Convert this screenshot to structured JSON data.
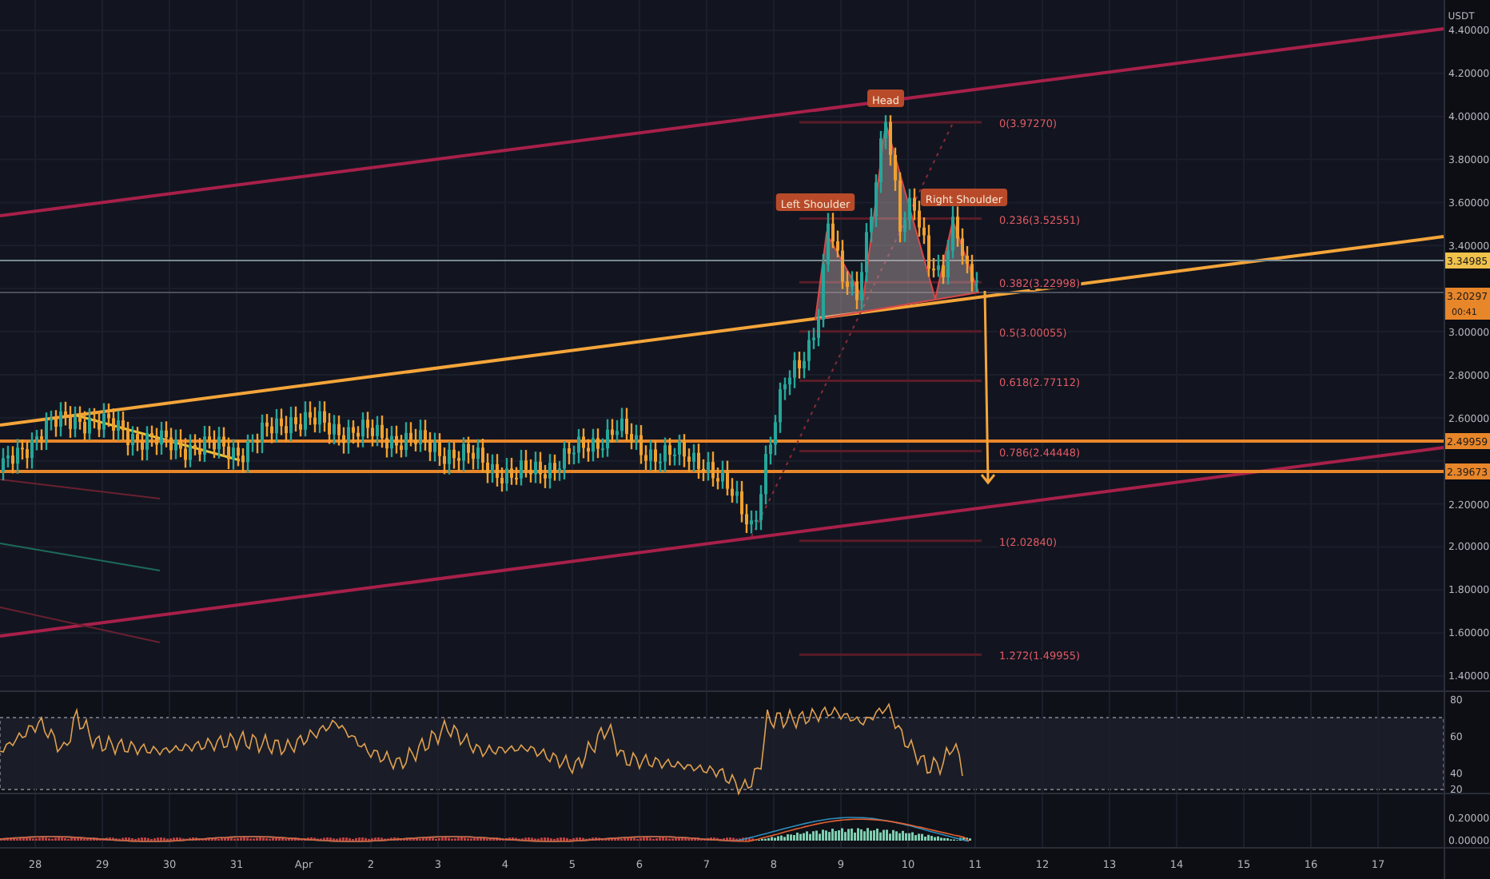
{
  "price_axis": {
    "currency": "USDT",
    "ticks": [
      "4.40000",
      "4.20000",
      "4.00000",
      "3.80000",
      "3.60000",
      "3.40000",
      "3.00000",
      "2.80000",
      "2.60000",
      "2.20000",
      "2.00000",
      "1.80000",
      "1.60000",
      "1.40000"
    ]
  },
  "price_tags": [
    {
      "label": "3.34985",
      "color": "#f0c24b"
    },
    {
      "label": "3.20297",
      "countdown": "00:41",
      "color": "#e8862a"
    },
    {
      "label": "2.49959",
      "color": "#e8862a"
    },
    {
      "label": "2.39673",
      "color": "#e8862a"
    }
  ],
  "pattern_labels": [
    {
      "text": "Left Shoulder"
    },
    {
      "text": "Head"
    },
    {
      "text": "Right Shoulder"
    }
  ],
  "fib_levels": [
    {
      "label": "0(3.97270)"
    },
    {
      "label": "0.236(3.52551)"
    },
    {
      "label": "0.382(3.22998)"
    },
    {
      "label": "0.5(3.00055)"
    },
    {
      "label": "0.618(2.77112)"
    },
    {
      "label": "0.786(2.44448)"
    },
    {
      "label": "1(2.02840)"
    },
    {
      "label": "1.272(1.49955)"
    }
  ],
  "rsi_axis": {
    "ticks": [
      "80",
      "60",
      "40",
      "20"
    ]
  },
  "macd_axis": {
    "ticks": [
      "0.20000",
      "0.00000"
    ]
  },
  "time_axis": [
    "28",
    "29",
    "30",
    "31",
    "Apr",
    "2",
    "3",
    "4",
    "5",
    "6",
    "7",
    "8",
    "9",
    "10",
    "11",
    "12",
    "13",
    "14",
    "15",
    "16",
    "17"
  ]
}
